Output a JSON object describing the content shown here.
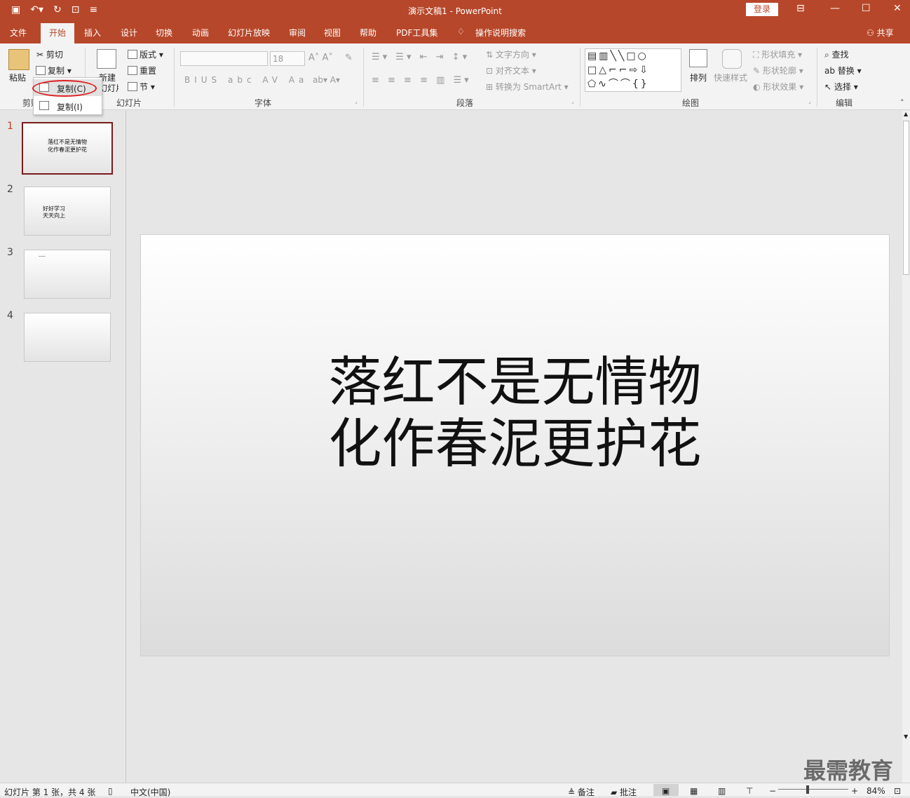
{
  "window": {
    "title": "演示文稿1  -  PowerPoint",
    "login": "登录",
    "share": "共享"
  },
  "tabs": [
    "文件",
    "开始",
    "插入",
    "设计",
    "切换",
    "动画",
    "幻灯片放映",
    "审阅",
    "视图",
    "帮助",
    "PDF工具集",
    "操作说明搜索"
  ],
  "clipboard": {
    "paste": "粘贴",
    "cut": "剪切",
    "copy": "复制",
    "group": "剪贴板"
  },
  "copy_menu": {
    "copy": "复制(C)",
    "duplicate": "复制(I)"
  },
  "slides_group": {
    "new_slide_1": "新建",
    "new_slide_2": "幻灯片",
    "layout": "版式",
    "reset": "重置",
    "section": "节",
    "label": "幻灯片"
  },
  "font_group": {
    "font_name": "",
    "font_size": "18",
    "label": "字体"
  },
  "paragraph_group": {
    "text_direction": "文字方向",
    "align_text": "对齐文本",
    "smartart": "转换为 SmartArt",
    "label": "段落"
  },
  "drawing_group": {
    "arrange": "排列",
    "quick_styles": "快速样式",
    "shape_fill": "形状填充",
    "shape_outline": "形状轮廓",
    "shape_effects": "形状效果",
    "label": "绘图"
  },
  "editing_group": {
    "find": "查找",
    "replace": "替换",
    "select": "选择",
    "label": "编辑"
  },
  "thumbnails": [
    {
      "num": "1",
      "line1": "落红不是无情物",
      "line2": "化作春泥更护花"
    },
    {
      "num": "2",
      "line1": "好好学习",
      "line2": "天天向上"
    },
    {
      "num": "3",
      "line1": "",
      "line2": ""
    },
    {
      "num": "4",
      "line1": "",
      "line2": ""
    }
  ],
  "slide": {
    "line1": "落红不是无情物",
    "line2": "化作春泥更护花"
  },
  "status": {
    "slide_info": "幻灯片 第 1 张，共 4 张",
    "language": "中文(中国)",
    "notes": "备注",
    "comments": "批注",
    "zoom": "84%"
  },
  "watermark": "最需教育"
}
